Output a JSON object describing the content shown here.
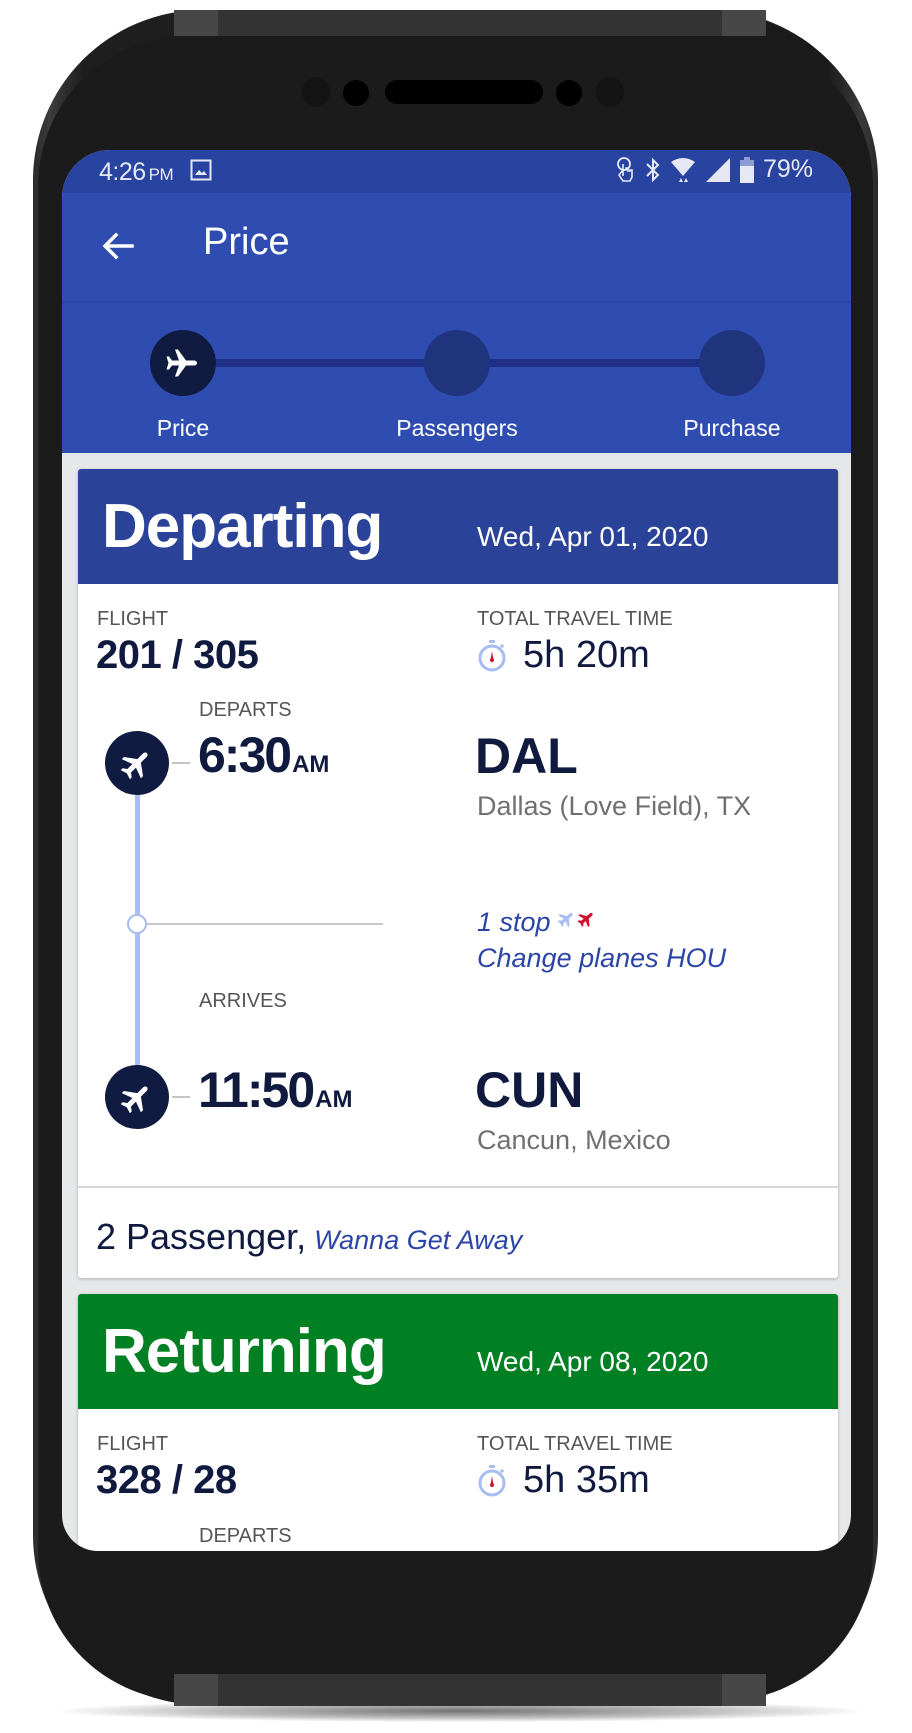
{
  "status_bar": {
    "time": "4:26",
    "ampm": "PM",
    "battery": "79%",
    "icons": [
      "image-icon",
      "touch-icon",
      "bluetooth-icon",
      "wifi-icon",
      "signal-icon",
      "battery-icon"
    ]
  },
  "toolbar": {
    "title": "Price",
    "back_icon": "arrow-left-icon"
  },
  "stepper": {
    "steps": [
      {
        "label": "Price",
        "active": true,
        "icon": "airplane-icon"
      },
      {
        "label": "Passengers",
        "active": false
      },
      {
        "label": "Purchase",
        "active": false
      }
    ]
  },
  "colors": {
    "status_bar": "#2944a0",
    "toolbar": "#2f4db1",
    "departing_header": "#2a4399",
    "returning_header": "#007f23",
    "navy_text": "#101a3e",
    "link_blue": "#2b45a6",
    "timeline": "#a8bdf0",
    "stop_red": "#d0112b"
  },
  "departing": {
    "title": "Departing",
    "date": "Wed, Apr 01, 2020",
    "flight_label": "FLIGHT",
    "flight_numbers": "201 / 305",
    "travel_time_label": "TOTAL TRAVEL TIME",
    "travel_time": "5h 20m",
    "departs_label": "DEPARTS",
    "depart_time": "6:30",
    "depart_ampm": "AM",
    "origin_code": "DAL",
    "origin_city": "Dallas (Love Field), TX",
    "stops": "1 stop",
    "change_planes": "Change planes HOU",
    "arrives_label": "ARRIVES",
    "arrive_time": "11:50",
    "arrive_ampm": "AM",
    "dest_code": "CUN",
    "dest_city": "Cancun, Mexico",
    "passengers": "2 Passenger,",
    "fare_type": "Wanna Get Away"
  },
  "returning": {
    "title": "Returning",
    "date": "Wed, Apr 08, 2020",
    "flight_label": "FLIGHT",
    "flight_numbers": "328 / 28",
    "travel_time_label": "TOTAL TRAVEL TIME",
    "travel_time": "5h 35m",
    "departs_label": "DEPARTS"
  }
}
